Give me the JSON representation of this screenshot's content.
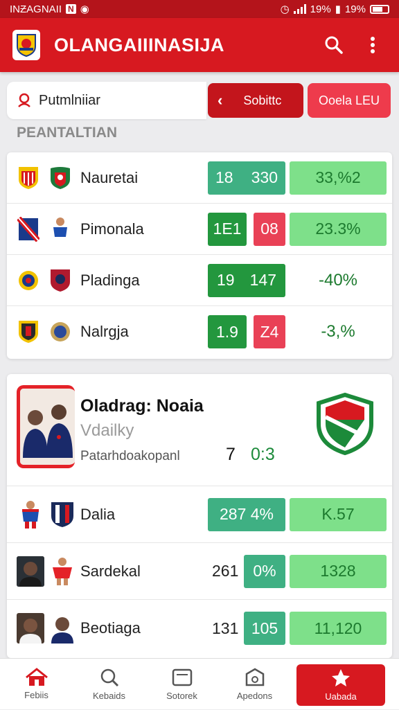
{
  "status_bar": {
    "carrier": "INƵAGNAII",
    "badge": "N",
    "battery_1": "19%",
    "battery_2": "19%"
  },
  "app_bar": {
    "title": "OLANGAIIINASIJA"
  },
  "filters": {
    "search_text": "Putmlniiar",
    "button_back": "Sobittc",
    "button_active": "Ooela LEU"
  },
  "section_label": "PEANTALTIAN",
  "matches": [
    {
      "team": "Nauretai",
      "score_a": "18",
      "score_b": "330",
      "odds": "33,%2",
      "colors": [
        "#3fb083",
        "#3fb083"
      ]
    },
    {
      "team": "Pimonala",
      "score_a": "1E1",
      "score_b": "08",
      "odds": "23.3%",
      "colors": [
        "#23973e",
        "#e94156"
      ]
    },
    {
      "team": "Pladinga",
      "score_a": "19",
      "score_b": "147",
      "odds": "-40%",
      "colors": [
        "#23973e",
        "#23973e"
      ]
    },
    {
      "team": "Nalrgja",
      "score_a": "1.9",
      "score_b": "Z4",
      "odds": "-3,%",
      "colors": [
        "#23973e",
        "#e94156"
      ]
    }
  ],
  "featured": {
    "title": "Oladrag: Noaia",
    "subtitle": "Vdailky",
    "league": "Patarhdoakopanl",
    "score_a": "7",
    "score_b": "0:3"
  },
  "players": [
    {
      "name": "Dalia",
      "value": "",
      "pct": "287  4%",
      "stat": "K.57"
    },
    {
      "name": "Sardekal",
      "value": "261",
      "pct": "0%",
      "stat": "1328"
    },
    {
      "name": "Beotiaga",
      "value": "131",
      "pct": "105",
      "stat": "11,120"
    }
  ],
  "bottom_nav": [
    {
      "label": "Febiis",
      "icon": "home-icon"
    },
    {
      "label": "Kebaids",
      "icon": "search-icon"
    },
    {
      "label": "Sotorek",
      "icon": "tv-icon"
    },
    {
      "label": "Apedons",
      "icon": "camera-icon"
    },
    {
      "label": "Uabada",
      "icon": "star-icon"
    }
  ],
  "colors": {
    "brand_red": "#d71920",
    "status_red": "#b4141b",
    "green": "#23973e",
    "light_green": "#7ee08a",
    "teal": "#3fb083",
    "pink": "#e94156"
  }
}
